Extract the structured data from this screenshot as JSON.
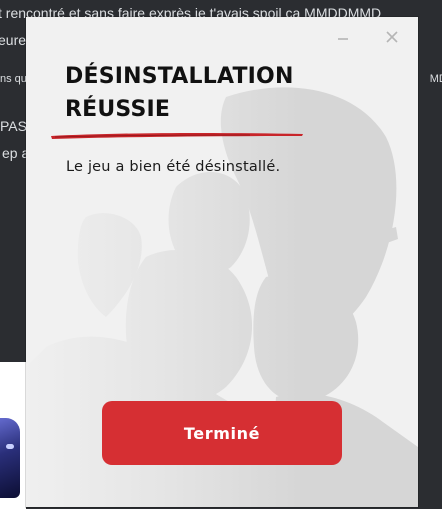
{
  "background": {
    "chat_lines": [
      "t rencontré et sans faire exprès je t'avais spoil ca MMDDMMD",
      "eure",
      "ns qu",
      "MDM",
      "PAS",
      "ep a"
    ]
  },
  "dialog": {
    "title": "DÉSINSTALLATION RÉUSSIE",
    "message": "Le jeu a bien été désinstallé.",
    "done_label": "Terminé",
    "minimize_icon": "minimize-icon",
    "close_icon": "close-icon",
    "accent_color": "#d62f33"
  }
}
